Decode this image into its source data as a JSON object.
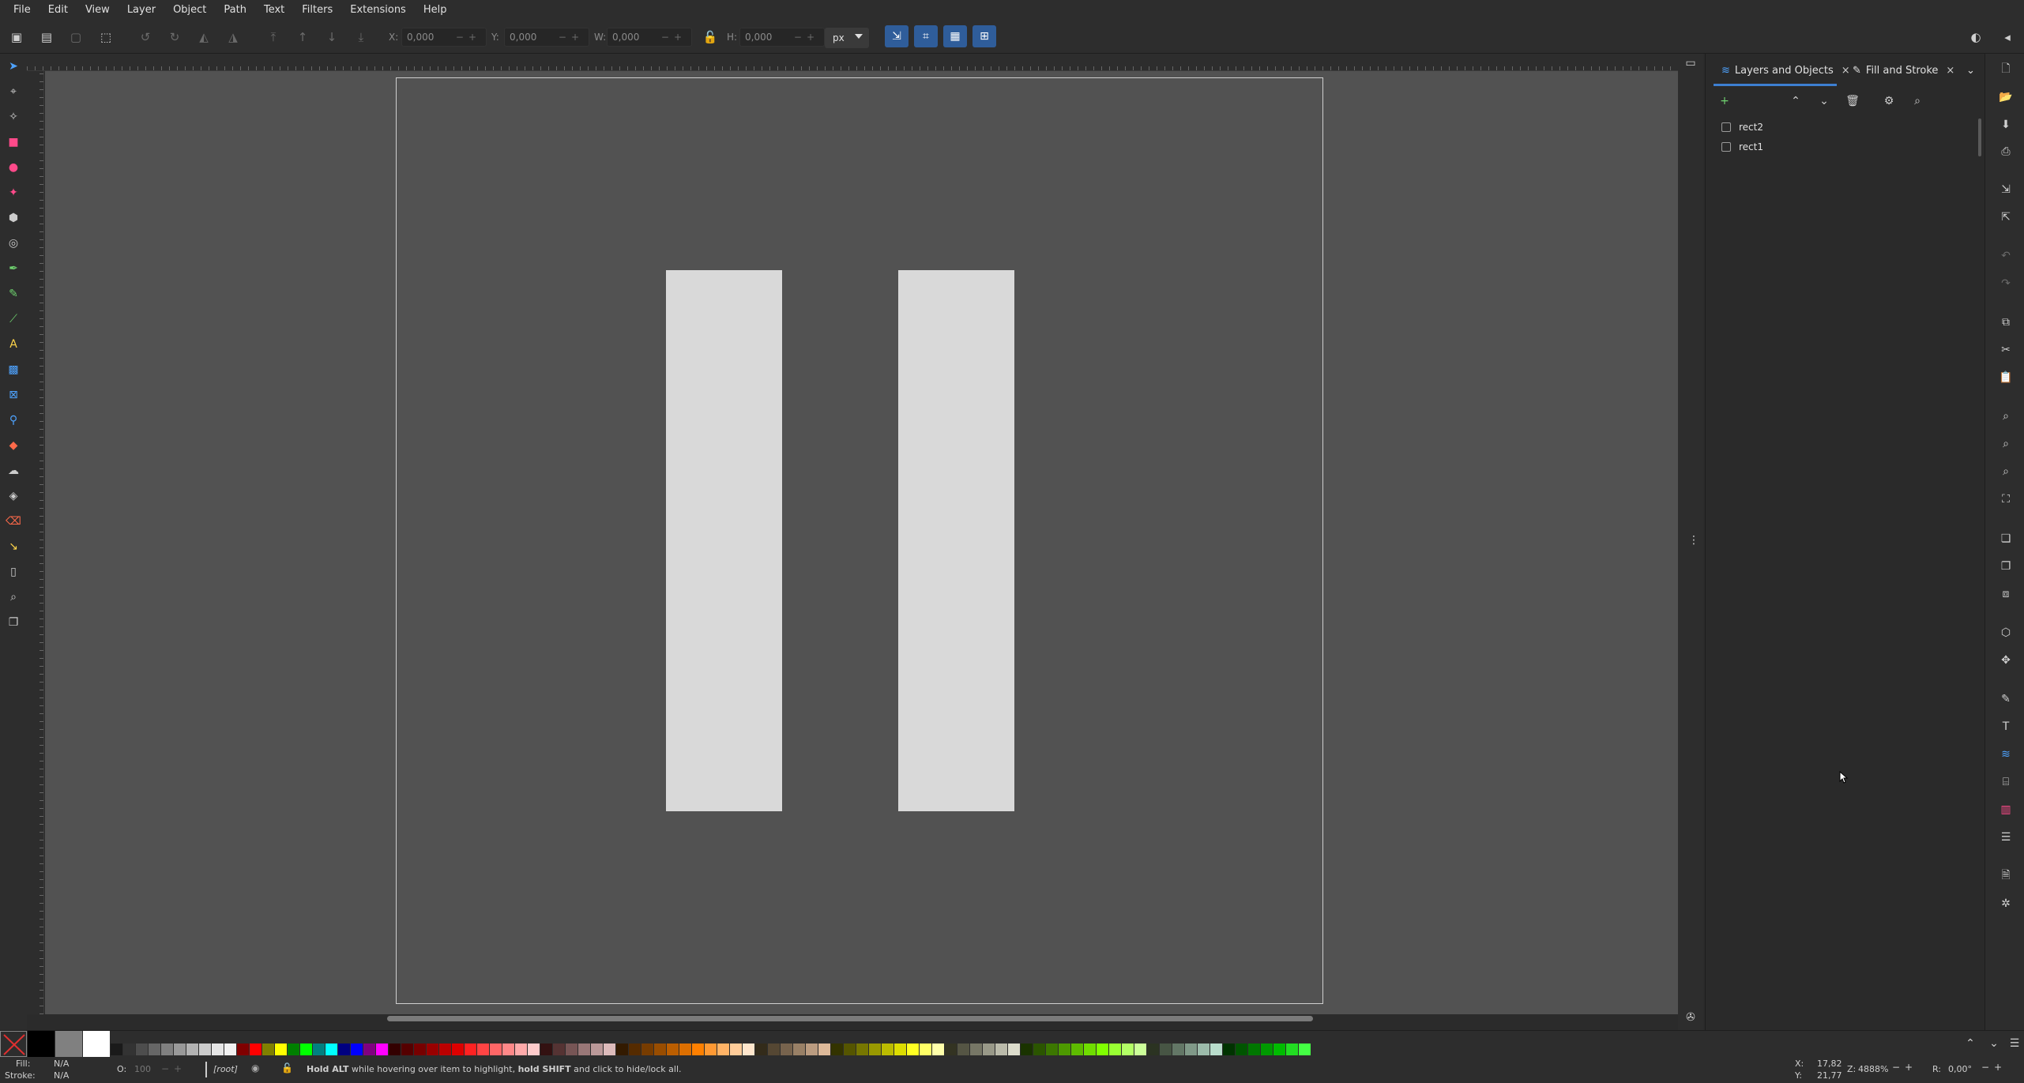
{
  "menu": [
    "File",
    "Edit",
    "View",
    "Layer",
    "Object",
    "Path",
    "Text",
    "Filters",
    "Extensions",
    "Help"
  ],
  "toolbar": {
    "x_label": "X:",
    "x_value": "0,000",
    "y_label": "Y:",
    "y_value": "0,000",
    "w_label": "W:",
    "w_value": "0,000",
    "h_label": "H:",
    "h_value": "0,000",
    "unit": "px"
  },
  "panel": {
    "tabs": [
      {
        "label": "Layers and Objects",
        "close": "×"
      },
      {
        "label": "Fill and Stroke",
        "close": "×"
      }
    ],
    "objects": [
      {
        "label": "rect2"
      },
      {
        "label": "rect1"
      }
    ]
  },
  "status": {
    "fill_label": "Fill:",
    "fill_value": "N/A",
    "stroke_label": "Stroke:",
    "stroke_value": "N/A",
    "opacity_label": "O:",
    "opacity_value": "100",
    "layer": "[root]",
    "message_b1": "Hold ALT",
    "message_t1": " while hovering over item to highlight, ",
    "message_b2": "hold SHIFT",
    "message_t2": " and click to hide/lock all.",
    "x_label": "X:",
    "x_value": "17,82",
    "y_label": "Y:",
    "y_value": "21,77",
    "zoom_label": "Z:",
    "zoom_value": "4888%",
    "rot_label": "R:",
    "rot_value": "0,00°"
  },
  "colors": {
    "canvas": "#525252",
    "rect_fill": "#d9d9d9",
    "accent": "#2f5d9a",
    "tab_underline": "#3d7fd1"
  }
}
